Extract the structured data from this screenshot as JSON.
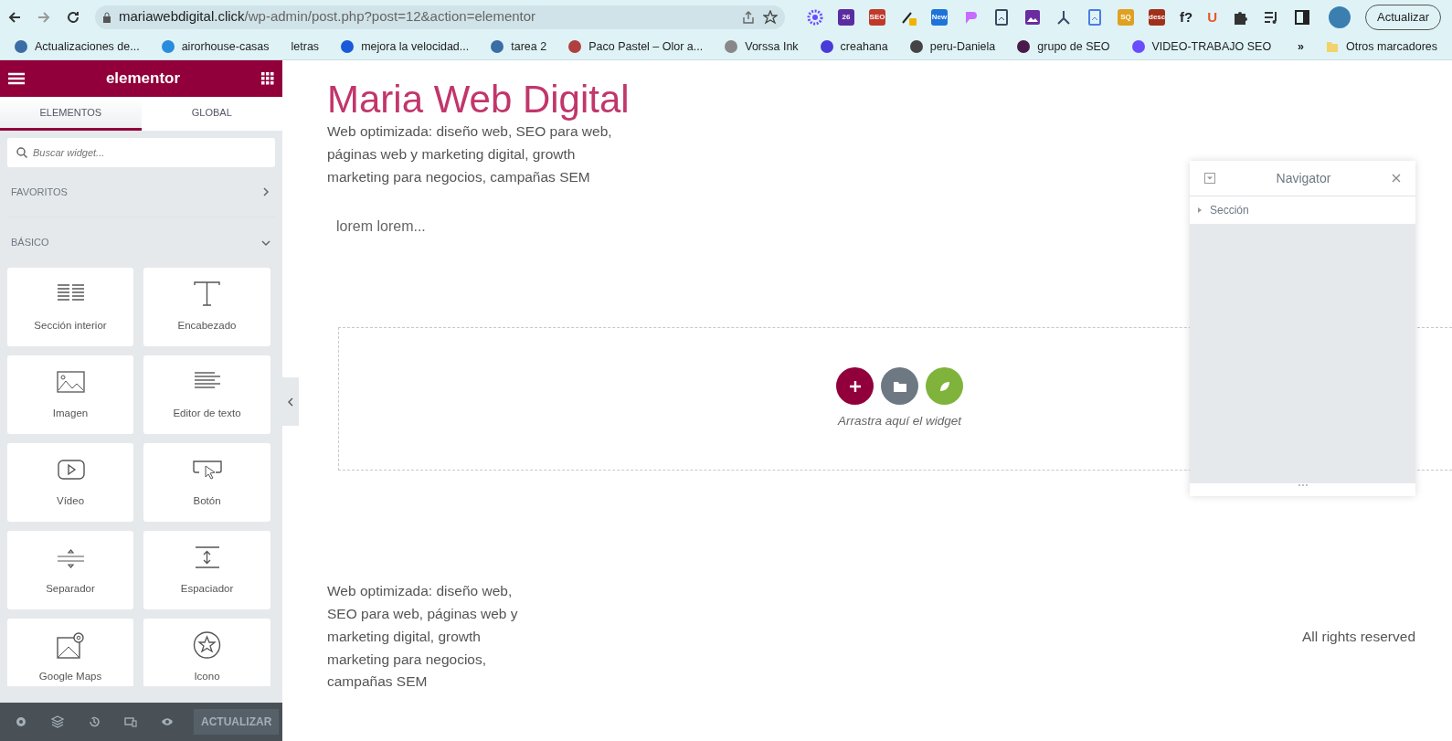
{
  "browser": {
    "url_host": "mariawebdigital.click",
    "url_path": "/wp-admin/post.php?post=12&action=elementor",
    "update_button": "Actualizar",
    "extensions": [
      {
        "kind": "flower",
        "color": "#6a4cff"
      },
      {
        "kind": "badge",
        "text": "26",
        "color": "#5b2ca0"
      },
      {
        "kind": "badge",
        "text": "SEO",
        "color": "#c0392b"
      },
      {
        "kind": "dropper",
        "color": "#f0b400"
      },
      {
        "kind": "badge",
        "text": "New",
        "color": "#1e73d8"
      },
      {
        "kind": "blob",
        "color": "#c86bff"
      },
      {
        "kind": "doc",
        "color": "#3c4a60"
      },
      {
        "kind": "image",
        "color": "#6a2ca0"
      },
      {
        "kind": "fork",
        "color": "#3a4a66"
      },
      {
        "kind": "doc",
        "color": "#4a7ee0"
      },
      {
        "kind": "badge",
        "text": "SQ",
        "color": "#e0a020"
      },
      {
        "kind": "badge",
        "text": "desc",
        "color": "#a0301a"
      },
      {
        "kind": "glyph",
        "text": "f?",
        "color": "#222222"
      },
      {
        "kind": "glyph",
        "text": "U",
        "color": "#e8572a"
      },
      {
        "kind": "puzzle",
        "color": "#333333"
      },
      {
        "kind": "list",
        "color": "#333333"
      },
      {
        "kind": "panel",
        "color": "#222222"
      }
    ],
    "bookmarks": [
      {
        "label": "Actualizaciones de...",
        "color": "#3a6ea5"
      },
      {
        "label": "airorhouse-casas",
        "color": "#2a8cdc"
      },
      {
        "label": "letras"
      },
      {
        "label": "mejora la velocidad...",
        "color": "#1a5ad8"
      },
      {
        "label": "tarea 2",
        "color": "#3a6ea5"
      },
      {
        "label": "Paco Pastel – Olor a...",
        "color": "#b04040"
      },
      {
        "label": "Vorssa Ink",
        "color": "#888888"
      },
      {
        "label": "creahana",
        "color": "#4a3ad8"
      },
      {
        "label": "peru-Daniela",
        "color": "#444444"
      },
      {
        "label": "grupo de SEO",
        "color": "#4a1a4a"
      },
      {
        "label": "VIDEO-TRABAJO SEO",
        "color": "#6a4cff"
      }
    ],
    "more_bookmarks": "»",
    "other_bookmarks": "Otros marcadores"
  },
  "sidebar": {
    "logo": "elementor",
    "tabs": [
      {
        "label": "ELEMENTOS",
        "selected": true
      },
      {
        "label": "GLOBAL",
        "selected": false
      }
    ],
    "search": {
      "placeholder": "Buscar widget..."
    },
    "sections": [
      {
        "title": "FAVORITOS",
        "expanded": false
      },
      {
        "title": "BÁSICO",
        "expanded": true
      }
    ],
    "widgets": [
      {
        "kind": "inner-section",
        "label": "Sección interior"
      },
      {
        "kind": "heading",
        "label": "Encabezado"
      },
      {
        "kind": "image",
        "label": "Imagen"
      },
      {
        "kind": "text",
        "label": "Editor de texto"
      },
      {
        "kind": "video",
        "label": "Vídeo"
      },
      {
        "kind": "button",
        "label": "Botón"
      },
      {
        "kind": "divider",
        "label": "Separador"
      },
      {
        "kind": "spacer",
        "label": "Espaciador"
      },
      {
        "kind": "map",
        "label": "Google Maps"
      },
      {
        "kind": "icon",
        "label": "Icono"
      }
    ],
    "footer_button": "ACTUALIZAR"
  },
  "canvas": {
    "title": "Maria Web Digital",
    "tagline": "Web optimizada: diseño web, SEO para web, páginas web y marketing digital, growth marketing para negocios, campañas SEM",
    "body": "lorem lorem...",
    "dropzone_hint": "Arrastra aquí el widget",
    "footer_text": "Web optimizada: diseño web, SEO para web, páginas web y marketing digital, growth marketing para negocios, campañas SEM",
    "footer_rights": "All rights reserved"
  },
  "navigator": {
    "title": "Navigator",
    "items": [
      {
        "label": "Sección",
        "expanded": false
      }
    ]
  }
}
